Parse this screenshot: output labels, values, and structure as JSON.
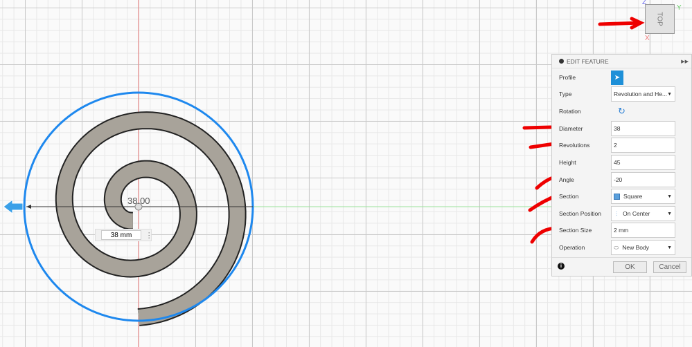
{
  "canvas": {
    "dimension_value": "38.00",
    "dimension_input": "38 mm"
  },
  "viewcube": {
    "face": "TOP",
    "axis_z": "Z",
    "axis_y": "Y",
    "axis_x": "X"
  },
  "panel": {
    "title": "EDIT FEATURE",
    "rows": [
      {
        "label": "Profile"
      },
      {
        "label": "Type",
        "value": "Revolution and He..."
      },
      {
        "label": "Rotation"
      },
      {
        "label": "Diameter",
        "value": "38"
      },
      {
        "label": "Revolutions",
        "value": "2"
      },
      {
        "label": "Height",
        "value": "45"
      },
      {
        "label": "Angle",
        "value": "-20"
      },
      {
        "label": "Section",
        "value": "Square"
      },
      {
        "label": "Section Position",
        "value": "On Center"
      },
      {
        "label": "Section Size",
        "value": "2 mm"
      },
      {
        "label": "Operation",
        "value": "New Body"
      }
    ],
    "ok": "OK",
    "cancel": "Cancel"
  },
  "colors": {
    "accent": "#1e90ff",
    "annotation": "#ee0000"
  }
}
